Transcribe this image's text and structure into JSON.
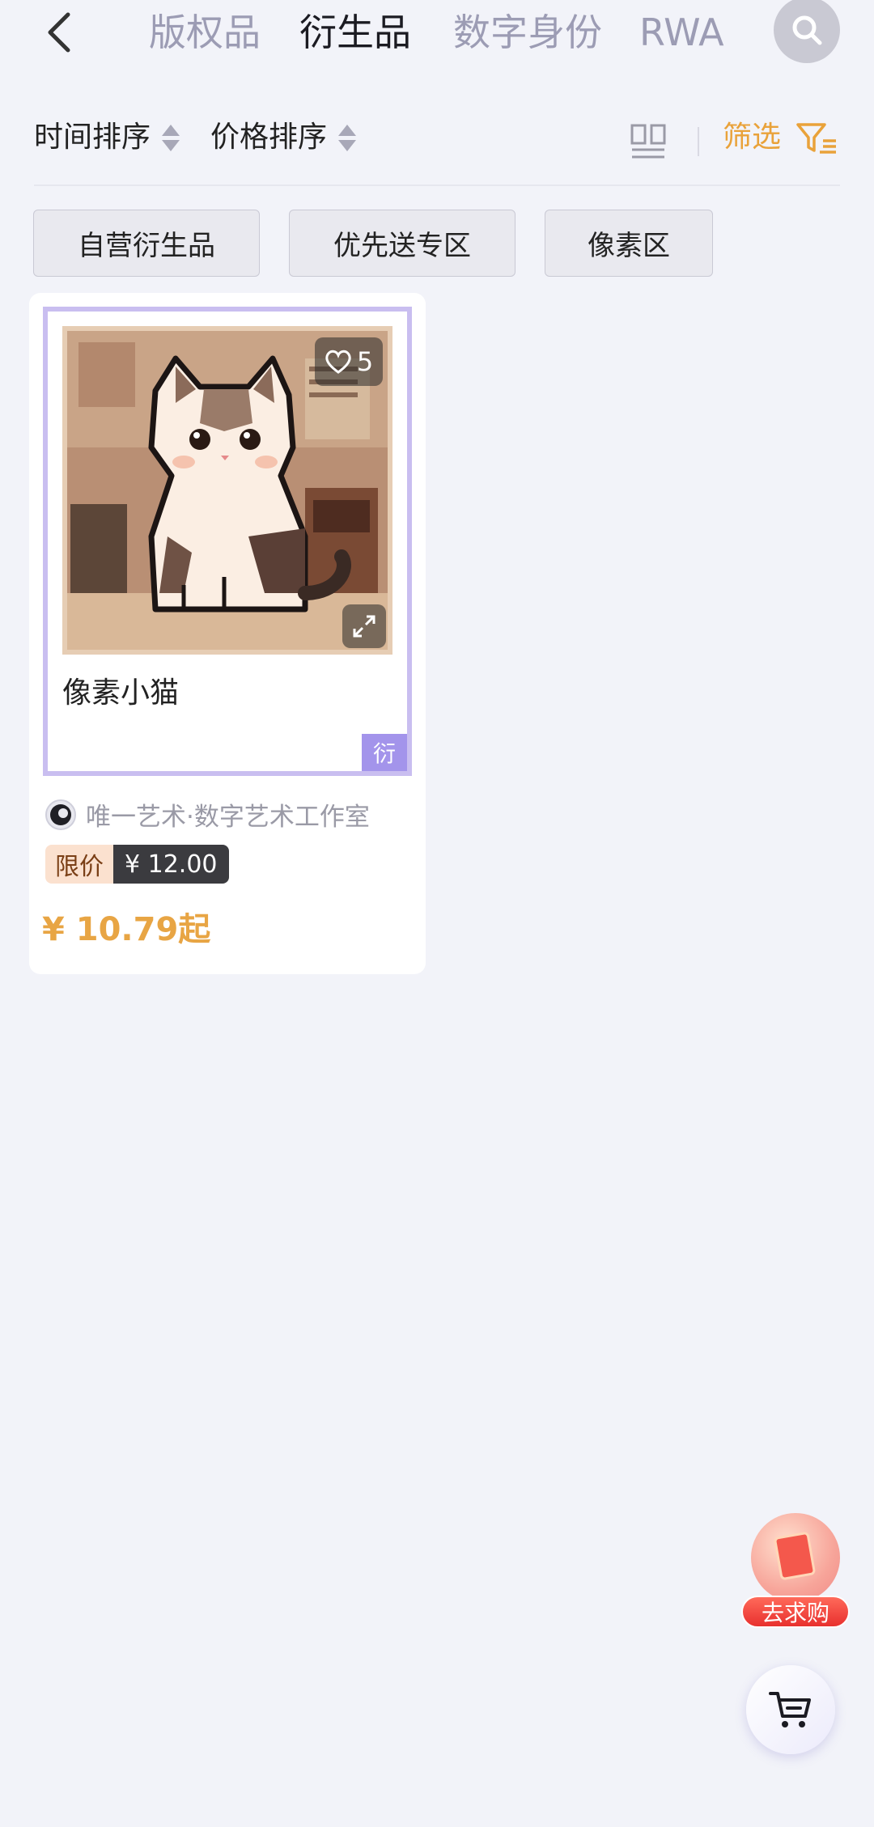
{
  "header": {
    "tabs": [
      {
        "label": "版权品",
        "active": false
      },
      {
        "label": "衍生品",
        "active": true
      },
      {
        "label": "数字身份",
        "active": false
      },
      {
        "label": "RWA",
        "active": false
      }
    ]
  },
  "sort": {
    "time_label": "时间排序",
    "price_label": "价格排序",
    "filter_label": "筛选"
  },
  "chips": [
    {
      "label": "自营衍生品"
    },
    {
      "label": "优先送专区"
    },
    {
      "label": "像素区"
    }
  ],
  "products": [
    {
      "name": "像素小猫",
      "likes": "5",
      "type_badge": "衍",
      "creator": "唯一艺术·数字艺术工作室",
      "limit_label": "限价",
      "limit_price": "¥ 12.00",
      "price": "¥ 10.79起"
    }
  ],
  "floating": {
    "wish_label": "去求购"
  },
  "colors": {
    "accent": "#e9a23a",
    "tab_inactive": "#9c9cb4",
    "frame": "#c9bef0",
    "badge": "#a394eb",
    "background": "#f2f3f9"
  }
}
